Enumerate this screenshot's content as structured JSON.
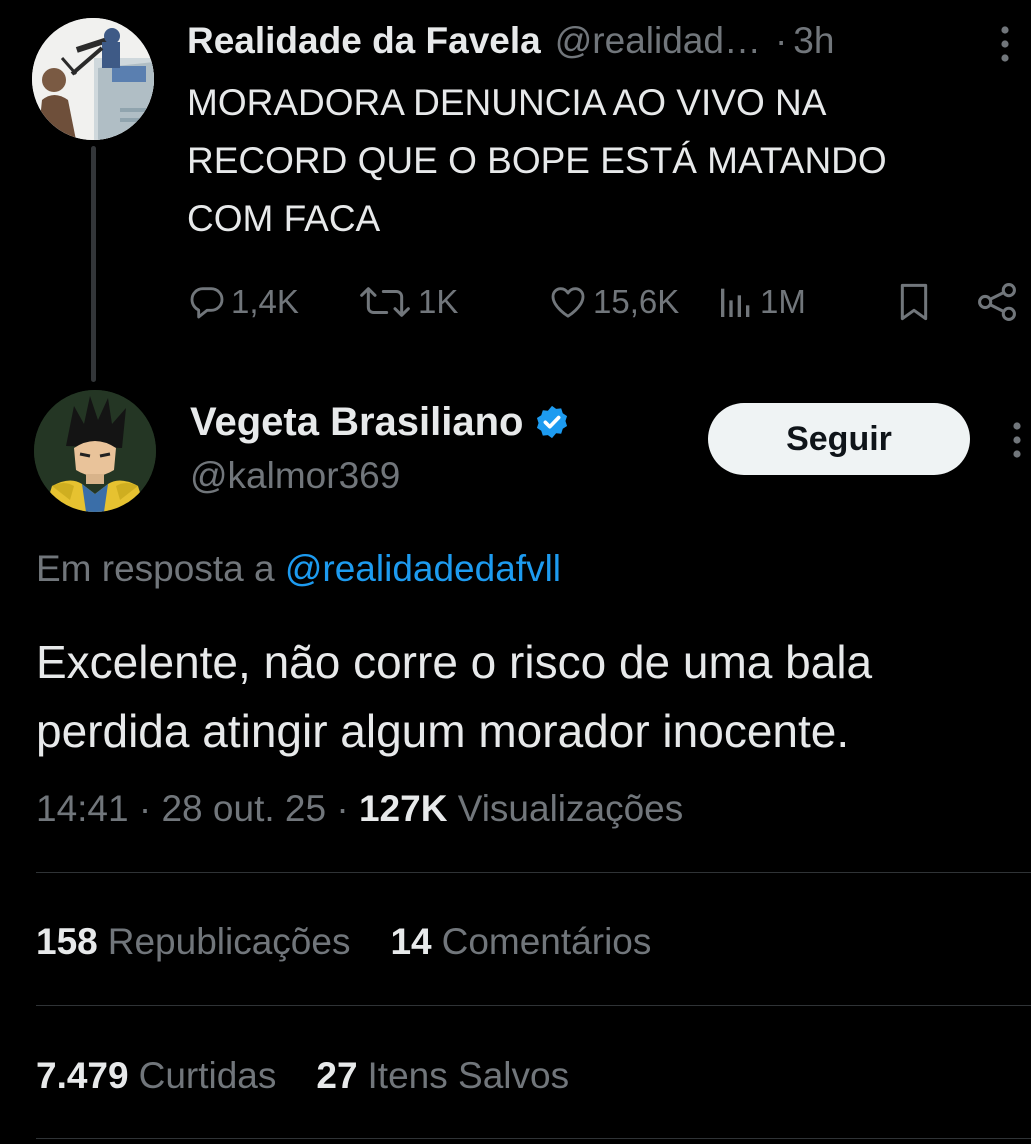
{
  "parent_tweet": {
    "author_name": "Realidade da Favela",
    "author_handle": "@realidad…",
    "separator": "·",
    "time": "3h",
    "text": "MORADORA DENUNCIA AO VIVO NA\nRECORD QUE O BOPE ESTÁ MATANDO\nCOM FACA",
    "actions": {
      "replies": "1,4K",
      "reposts": "1K",
      "likes": "15,6K",
      "views": "1M"
    },
    "avatar_icon": "avatar-cartoon-icon"
  },
  "reply_tweet": {
    "author_name": "Vegeta Brasiliano",
    "author_handle": "@kalmor369",
    "follow_label": "Seguir",
    "replying_to_prefix": "Em resposta a ",
    "replying_to_handle": "@realidadedafvll",
    "text_line1": "Excelente, não corre o risco de uma bala",
    "text_line2": "perdida atingir algum morador inocente.",
    "time": "14:41",
    "date": "28 out. 25",
    "sep": " · ",
    "views_count": "127K",
    "views_label": "Visualizações",
    "avatar_icon": "avatar-anime-character-icon"
  },
  "stats": {
    "reposts_count": "158",
    "reposts_label": "Republicações",
    "comments_count": "14",
    "comments_label": "Comentários",
    "likes_count": "7.479",
    "likes_label": "Curtidas",
    "saves_count": "27",
    "saves_label": "Itens Salvos"
  },
  "colors": {
    "background": "#000000",
    "text_primary": "#e7e9ea",
    "text_secondary": "#71767b",
    "link": "#1d9bf0",
    "verified": "#1d9bf0",
    "follow_bg": "#eff3f4",
    "divider": "#2f3336"
  }
}
